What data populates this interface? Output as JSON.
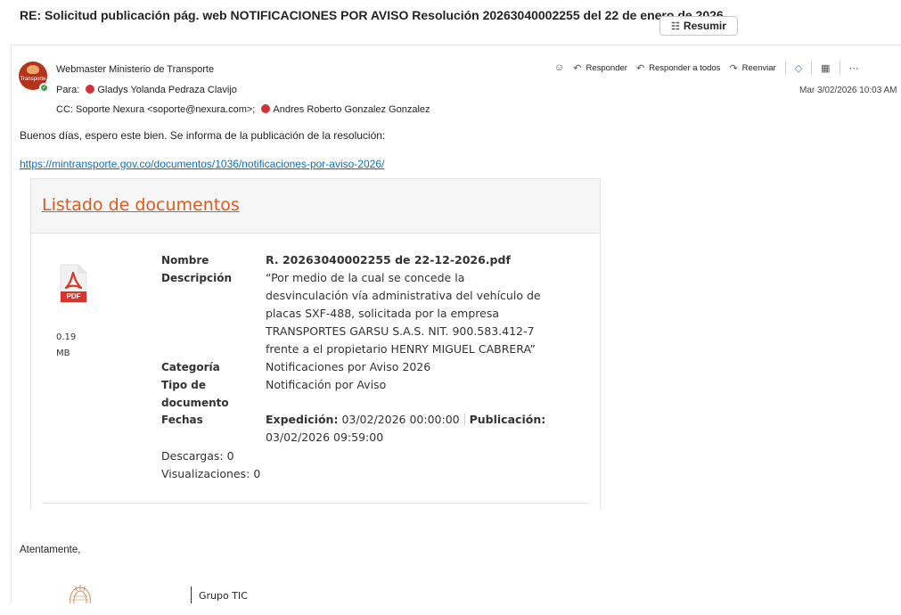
{
  "email": {
    "subject": "RE: Solicitud publicación pág. web NOTIFICACIONES POR AVISO Resolución 20263040002255 del 22 de enero de 2026",
    "summarize_label": "Resumir",
    "sender": "Webmaster Ministerio de Transporte",
    "avatar_text": "Transporte",
    "to_label": "Para:",
    "to_name": "Gladys Yolanda Pedraza Clavijo",
    "cc_label": "CC:",
    "cc_1": "Soporte Nexura <soporte@nexura.com>;",
    "cc_2": "Andres Roberto Gonzalez Gonzalez",
    "date": "Mar 3/02/2026 10:03 AM",
    "greeting": "Buenos días, espero este bien. Se informa de la publicación de la resolución:",
    "link": "https://mintransporte.gov.co/documentos/1036/notificaciones-por-aviso-2026/",
    "closing": "Atentamente,",
    "signature_group": "Grupo TIC"
  },
  "actions": {
    "reply": "Responder",
    "reply_all": "Responder a todos",
    "forward": "Reenviar"
  },
  "document": {
    "listing_title": "Listado de documentos",
    "file_size_value": "0.19",
    "file_size_unit": "MB",
    "pdf_badge": "PDF",
    "name_label": "Nombre",
    "name_value": "R. 20263040002255 de 22-12-2026.pdf",
    "desc_label": "Descripción",
    "desc_lines": [
      "“Por medio de la cual se concede la",
      "desvinculación vía administrativa del vehículo de",
      "placas SXF-488, solicitada por la empresa",
      "TRANSPORTES GARSU S.A.S. NIT. 900.583.412-7",
      "frente a el propietario HENRY MIGUEL CABRERA”"
    ],
    "category_label": "Categoría",
    "category_value": "Notificaciones por Aviso 2026",
    "type_label_1": "Tipo de",
    "type_label_2": "documento",
    "type_value": "Notificación por Aviso",
    "dates_label": "Fechas",
    "expedicion_label": "Expedición:",
    "expedicion_value": "03/02/2026 00:00:00",
    "publicacion_label": "Publicación:",
    "publicacion_value": "03/02/2026 09:59:00",
    "downloads": "Descargas: 0",
    "views": "Visualizaciones: 0"
  },
  "colors": {
    "link": "#0f6cbd",
    "listing_title": "#e05a1e",
    "presence": "#3aa243",
    "recipient_dot": "#d13438",
    "pdf_red": "#d9342b"
  },
  "icons": [
    "summarize-icon",
    "emoji-icon",
    "reply-icon",
    "reply-all-icon",
    "forward-icon",
    "loop-icon",
    "apps-icon",
    "more-icon",
    "pdf-icon",
    "presence-icon",
    "seal-icon"
  ]
}
